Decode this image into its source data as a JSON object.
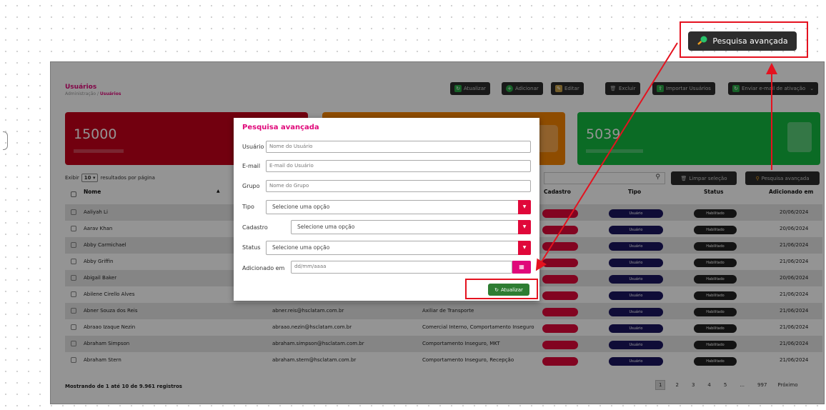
{
  "top_button": {
    "label": "Pesquisa avançada",
    "icon": "magnifier-icon"
  },
  "header": {
    "title": "Usuários",
    "breadcrumb_root": "Administração /",
    "breadcrumb_current": "Usuários"
  },
  "toolbar": {
    "update": "Atualizar",
    "add": "Adicionar",
    "edit": "Editar",
    "delete": "Excluir",
    "import": "Importar Usuários",
    "send_email": "Enviar e-mail de ativação"
  },
  "cards": [
    {
      "value": "15000",
      "color": "#c4001a"
    },
    {
      "value": "",
      "color": "#f58300"
    },
    {
      "value": "5039",
      "color": "#14b840"
    }
  ],
  "controls": {
    "show_label": "Exibir",
    "page_size": "10",
    "per_page_suffix": "resultados por página",
    "clear_selection": "Limpar seleção",
    "advanced_search": "Pesquisa avançada"
  },
  "table": {
    "headers": {
      "name": "Nome",
      "cadastro": "Cadastro",
      "tipo": "Tipo",
      "status": "Status",
      "added": "Adicionado em"
    },
    "rows": [
      {
        "name": "Aaliyah Li",
        "email": "",
        "dept": "",
        "tipo": "Usuário",
        "status": "Habilitado",
        "date": "20/06/2024"
      },
      {
        "name": "Aarav Khan",
        "email": "",
        "dept": "",
        "tipo": "Usuário",
        "status": "Habilitado",
        "date": "20/06/2024"
      },
      {
        "name": "Abby Carmichael",
        "email": "",
        "dept": "",
        "tipo": "Usuário",
        "status": "Habilitado",
        "date": "21/06/2024"
      },
      {
        "name": "Abby Griffin",
        "email": "",
        "dept": "",
        "tipo": "Usuário",
        "status": "Habilitado",
        "date": "21/06/2024"
      },
      {
        "name": "Abigail Baker",
        "email": "",
        "dept": "",
        "tipo": "Usuário",
        "status": "Habilitado",
        "date": "20/06/2024"
      },
      {
        "name": "Abilene Cirello Alves",
        "email": "",
        "dept": "",
        "tipo": "Usuário",
        "status": "Habilitado",
        "date": "21/06/2024"
      },
      {
        "name": "Abner Souza dos Reis",
        "email": "abner.reis@hsclatam.com.br",
        "dept": "Axiliar de Transporte",
        "tipo": "Usuário",
        "status": "Habilitado",
        "date": "21/06/2024"
      },
      {
        "name": "Abraao Izaque Nezin",
        "email": "abraao.nezin@hsclatam.com.br",
        "dept": "Comercial Interno, Comportamento Inseguro",
        "tipo": "Usuário",
        "status": "Habilitado",
        "date": "21/06/2024"
      },
      {
        "name": "Abraham Simpson",
        "email": "abraham.simpson@hsclatam.com.br",
        "dept": "Comportamento Inseguro, MKT",
        "tipo": "Usuário",
        "status": "Habilitado",
        "date": "21/06/2024"
      },
      {
        "name": "Abraham Stern",
        "email": "abraham.stern@hsclatam.com.br",
        "dept": "Comportamento Inseguro, Recepção",
        "tipo": "Usuário",
        "status": "Habilitado",
        "date": "21/06/2024"
      }
    ]
  },
  "footer": {
    "info": "Mostrando de 1 até 10 de 9.961 registros",
    "pages": [
      "1",
      "2",
      "3",
      "4",
      "5",
      "...",
      "997"
    ],
    "next": "Próximo"
  },
  "modal": {
    "title": "Pesquisa avançada",
    "usuario_label": "Usuário",
    "usuario_placeholder": "Nome do Usuário",
    "email_label": "E-mail",
    "email_placeholder": "E-mail do Usuário",
    "grupo_label": "Grupo",
    "grupo_placeholder": "Nome do Grupo",
    "tipo_label": "Tipo",
    "tipo_value": "Selecione uma opção",
    "cadastro_label": "Cadastro",
    "cadastro_value": "Selecione uma opção",
    "status_label": "Status",
    "status_value": "Selecione uma opção",
    "added_label": "Adicionado em",
    "added_placeholder": "dd/mm/aaaa",
    "update_button": "Atualizar"
  },
  "colors": {
    "accent": "#e0087a",
    "highlight": "#e4121f",
    "tipo_pill": "#1a1560",
    "cadastro_pill": "#e0083a"
  }
}
